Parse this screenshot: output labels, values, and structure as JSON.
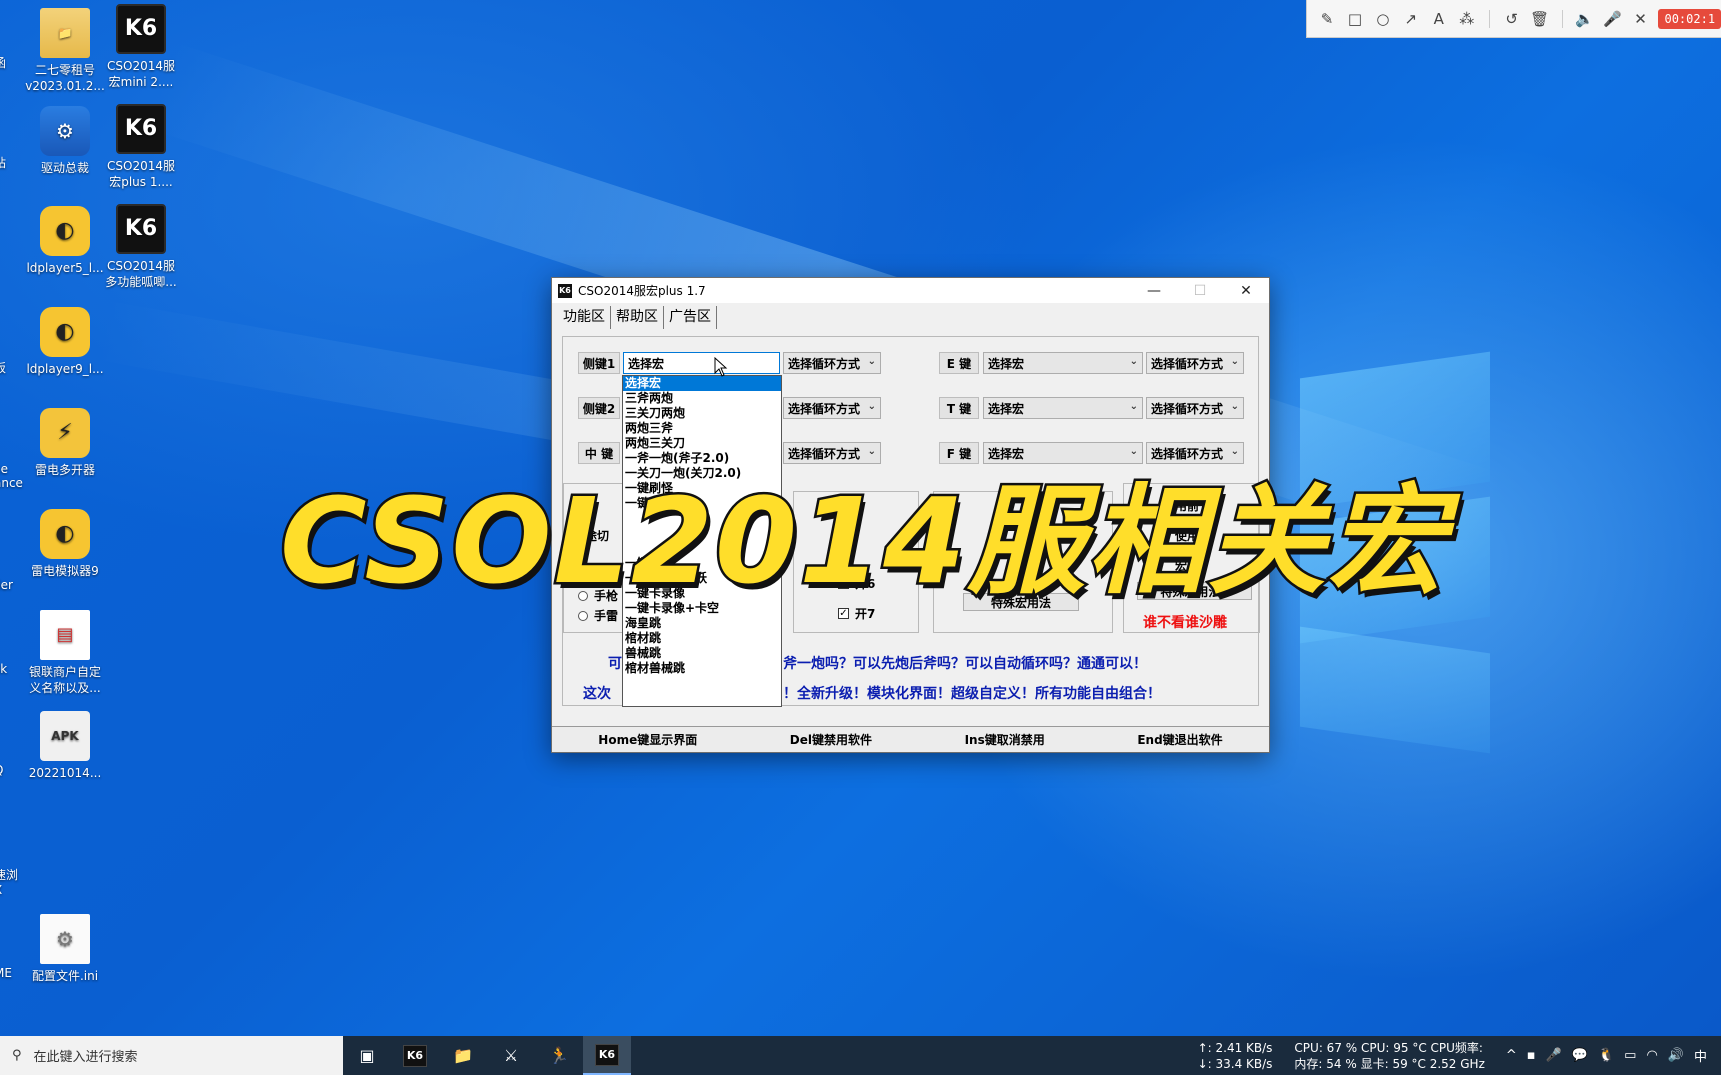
{
  "desktop": {
    "icons": [
      {
        "label": "二七零租号\nv2023.01.2...",
        "icon": "folder-icon"
      },
      {
        "label": "CSO2014服\n宏mini 2....",
        "icon": "k6-icon"
      },
      {
        "label": "驱动总裁",
        "icon": "driver-icon"
      },
      {
        "label": "CSO2014服\n宏plus 1....",
        "icon": "k6-icon"
      },
      {
        "label": "ldplayer5_l...",
        "icon": "ldplayer-icon"
      },
      {
        "label": "CSO2014服\n多功能呱唧...",
        "icon": "k6-icon"
      },
      {
        "label": "ldplayer9_l...",
        "icon": "ldplayer-icon"
      },
      {
        "label": "雷电多开器",
        "icon": "multi-open-icon"
      },
      {
        "label": "雷电模拟器9",
        "icon": "ldplayer-icon"
      },
      {
        "label": "银联商户自定\n义名称以及...",
        "icon": "document-icon"
      },
      {
        "label": "20221014...",
        "icon": "apk-icon"
      },
      {
        "label": "配置文件.ini",
        "icon": "ini-file-icon"
      }
    ],
    "edge_labels": [
      "函",
      "站",
      "板",
      "ce\nance",
      "ller",
      "sk",
      "Q",
      "速浏\nX",
      "ME"
    ]
  },
  "recorder": {
    "time": "00:02:1",
    "tools": [
      "pencil-icon",
      "rectangle-icon",
      "circle-icon",
      "arrow-icon",
      "text-icon",
      "magic-wand-icon",
      "undo-icon",
      "trash-icon",
      "speaker-icon",
      "microphone-icon",
      "close-icon"
    ]
  },
  "window": {
    "title": "CSO2014服宏plus 1.7",
    "logo": "K6",
    "tabs": [
      "功能区",
      "帮助区",
      "广告区"
    ],
    "rows": [
      {
        "key": "侧键1",
        "macro": "选择宏",
        "mode": "选择循环方式"
      },
      {
        "key": "侧键2",
        "macro": "选择宏",
        "mode": "选择循环方式"
      },
      {
        "key": "中  键",
        "macro": "选择宏",
        "mode": "选择循环方式"
      }
    ],
    "rows_right": [
      {
        "key": "E  键",
        "macro": "选择宏",
        "mode": "选择循环方式"
      },
      {
        "key": "T  键",
        "macro": "选择宏",
        "mode": "选择循环方式"
      },
      {
        "key": "F  键",
        "macro": "选择宏",
        "mode": "选择循环方式"
      }
    ],
    "mid_switch_label": "中途切",
    "radios": [
      "手枪",
      "手雷"
    ],
    "checkboxes": [
      {
        "label": "开6",
        "checked": true
      },
      {
        "label": "开7",
        "checked": true
      }
    ],
    "partial_labels": {
      "open_before": "用前",
      "use": "使用",
      "use2": "宏用",
      "key_label": "日"
    },
    "special_buttons": [
      "特殊宏用法",
      "特殊宏用法2"
    ],
    "red_slogan": "谁不看谁沙雕",
    "blue_line1_prefix": "可",
    "blue_line1": "斧一炮吗？可以先炮后斧吗？可以自动循环吗？通通可以！",
    "blue_line2_prefix": "这次",
    "blue_line2": "！全新升级！模块化界面！超级自定义！所有功能自由组合！",
    "status": [
      "Home键显示界面",
      "Del键禁用软件",
      "Ins键取消禁用",
      "End键退出软件"
    ]
  },
  "dropdown": {
    "options": [
      "选择宏",
      "三斧两炮",
      "三关刀两炮",
      "两炮三斧",
      "两炮三关刀",
      "一斧一炮(斧子2.0)",
      "一关刀一炮(关刀2.0)",
      "一键刷怪",
      "一键升级",
      "",
      "",
      "",
      "一键卡空",
      "一键卡空+跳跃",
      "一键卡录像",
      "一键卡录像+卡空",
      "海皇跳",
      "棺材跳",
      "兽械跳",
      "棺材兽械跳"
    ],
    "selected_index": 0
  },
  "overlay_title": "CSOL2014服相关宏",
  "taskbar": {
    "search_placeholder": "在此键入进行搜索",
    "net_up": "↑: 2.41 KB/s",
    "net_down": "↓: 33.4 KB/s",
    "cpu_line": "CPU: 67 % CPU: 95 °C  CPU频率:",
    "mem_line": "内存: 54 % 显卡: 59 °C  2.52 GHz",
    "ime": "中"
  }
}
